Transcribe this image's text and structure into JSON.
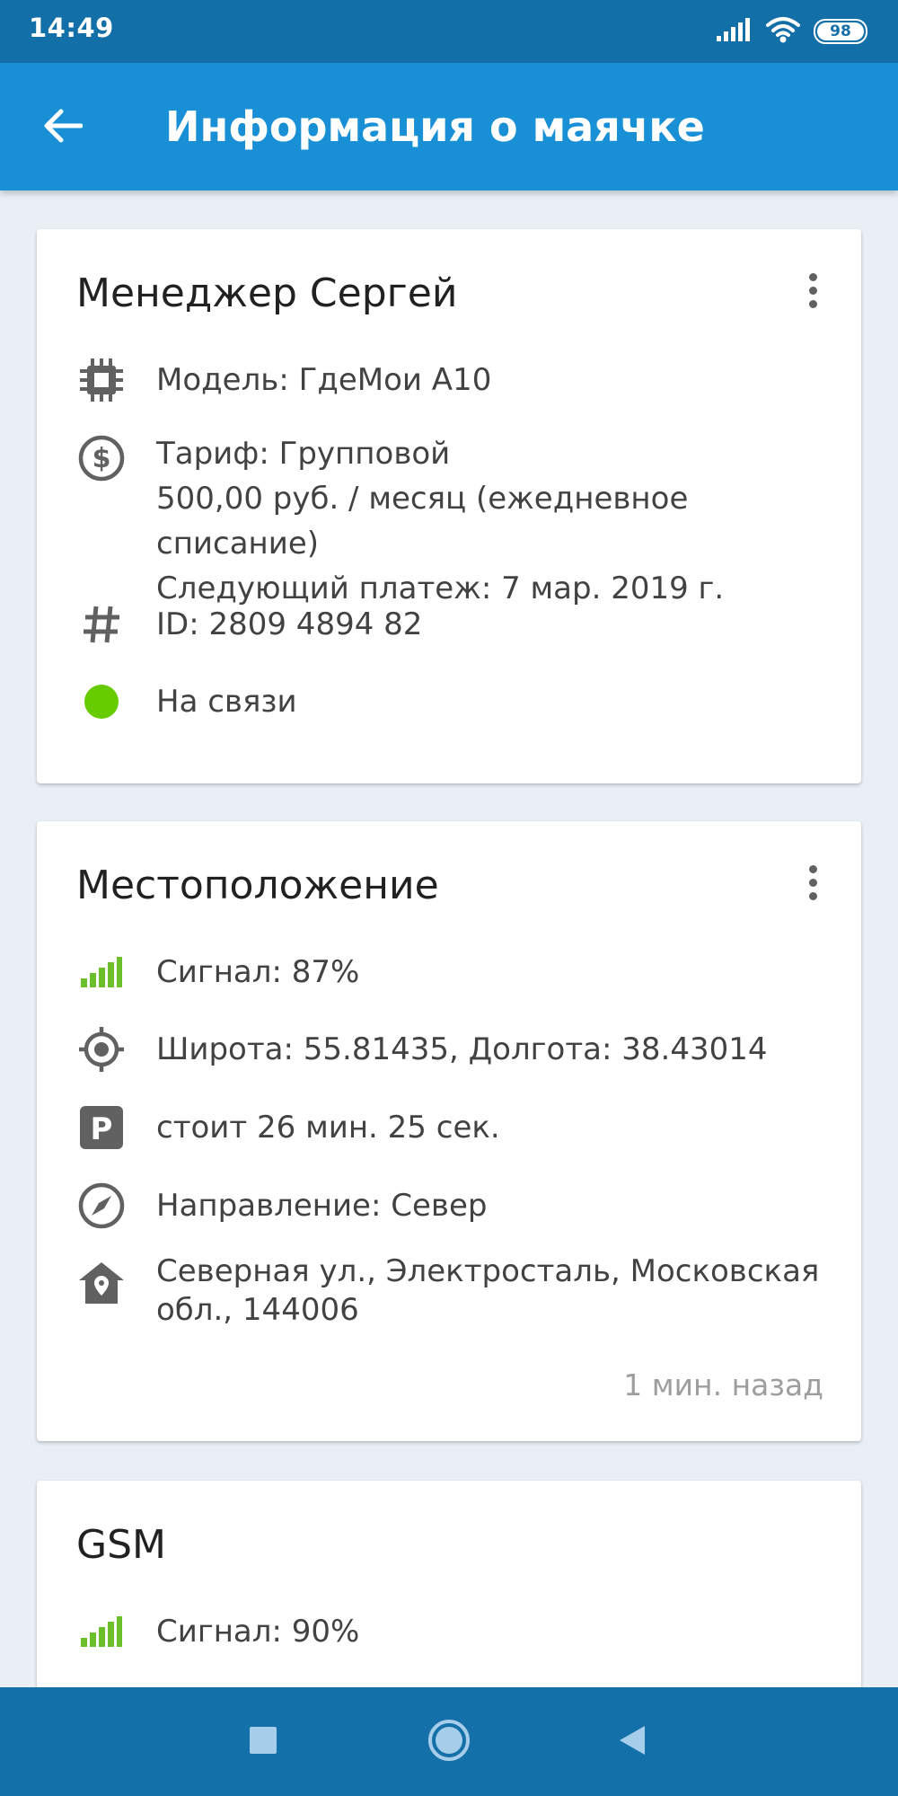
{
  "status_bar": {
    "time": "14:49",
    "battery": "98",
    "icons": [
      "signal-icon",
      "wifi-icon",
      "battery-icon"
    ]
  },
  "app_bar": {
    "title": "Информация о маячке",
    "icons": [
      "back-arrow-icon"
    ]
  },
  "cards": {
    "beacon": {
      "title": "Менеджер Сергей",
      "model": "Модель: ГдеМои А10",
      "tariff_line1": "Тариф: Групповой",
      "tariff_line2": "500,00 руб. / месяц (ежедневное списание)",
      "tariff_line3": "Следующий платеж: 7 мар. 2019 г.",
      "id": "ID: 2809 4894 82",
      "status": "На связи"
    },
    "location": {
      "title": "Местоположение",
      "signal": "Сигнал: 87%",
      "coords": "Широта: 55.81435, Долгота: 38.43014",
      "parked": "стоит 26 мин. 25 сек.",
      "direction": "Направление: Север",
      "address": "Северная ул., Электросталь, Московская обл., 144006",
      "timestamp": "1 мин. назад"
    },
    "gsm": {
      "title": "GSM",
      "signal": "Сигнал: 90%"
    }
  },
  "colors": {
    "status_bar": "#136fa7",
    "app_bar": "#1990d5",
    "nav_bar": "#1470a8",
    "online": "#66cc00",
    "signal_green": "#6bbf2a",
    "icon_gray": "#616161",
    "background": "#e9eff5"
  },
  "nav_bar": {
    "icons": [
      "recents-square-icon",
      "home-circle-icon",
      "back-triangle-icon"
    ]
  }
}
